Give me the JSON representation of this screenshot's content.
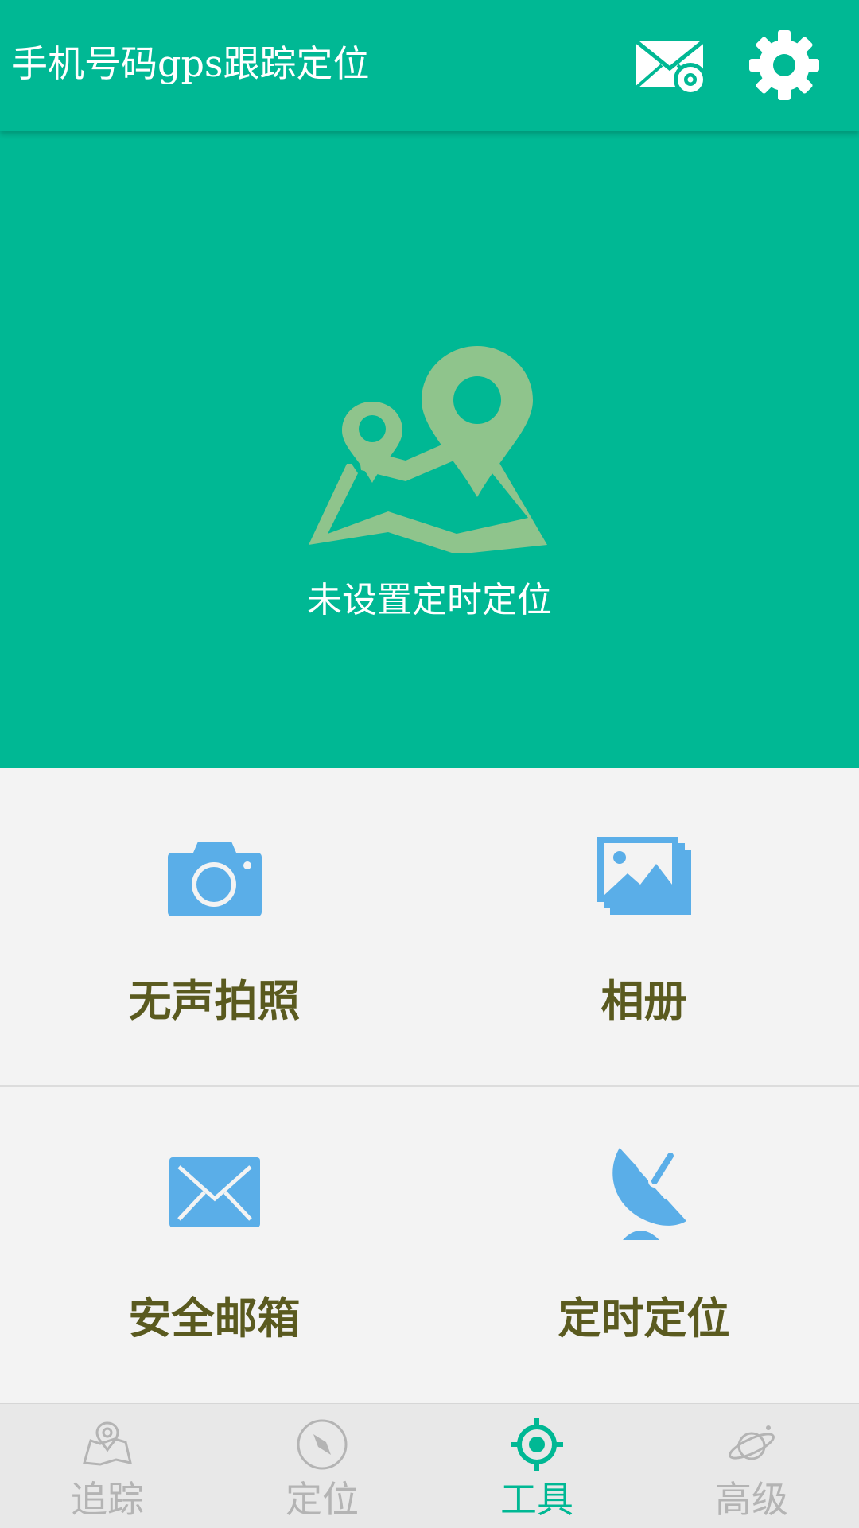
{
  "header": {
    "title": "手机号码gps跟踪定位",
    "mail_icon": "mail-settings-icon",
    "settings_icon": "gear-icon"
  },
  "hero": {
    "icon": "map-pins-icon",
    "status_text": "未设置定时定位"
  },
  "tools": [
    {
      "label": "无声拍照",
      "icon": "camera-icon"
    },
    {
      "label": "相册",
      "icon": "photo-album-icon"
    },
    {
      "label": "安全邮箱",
      "icon": "envelope-icon"
    },
    {
      "label": "定时定位",
      "icon": "satellite-dish-icon"
    }
  ],
  "tabs": [
    {
      "label": "追踪",
      "icon": "map-icon",
      "active": false
    },
    {
      "label": "定位",
      "icon": "compass-icon",
      "active": false
    },
    {
      "label": "工具",
      "icon": "target-icon",
      "active": true
    },
    {
      "label": "高级",
      "icon": "planet-icon",
      "active": false
    }
  ],
  "colors": {
    "primary": "#00b894",
    "tool_icon": "#5aaee8",
    "hero_icon": "#8fc48c",
    "label_text": "#5a5a1f",
    "tab_inactive": "#b4b4b4"
  }
}
